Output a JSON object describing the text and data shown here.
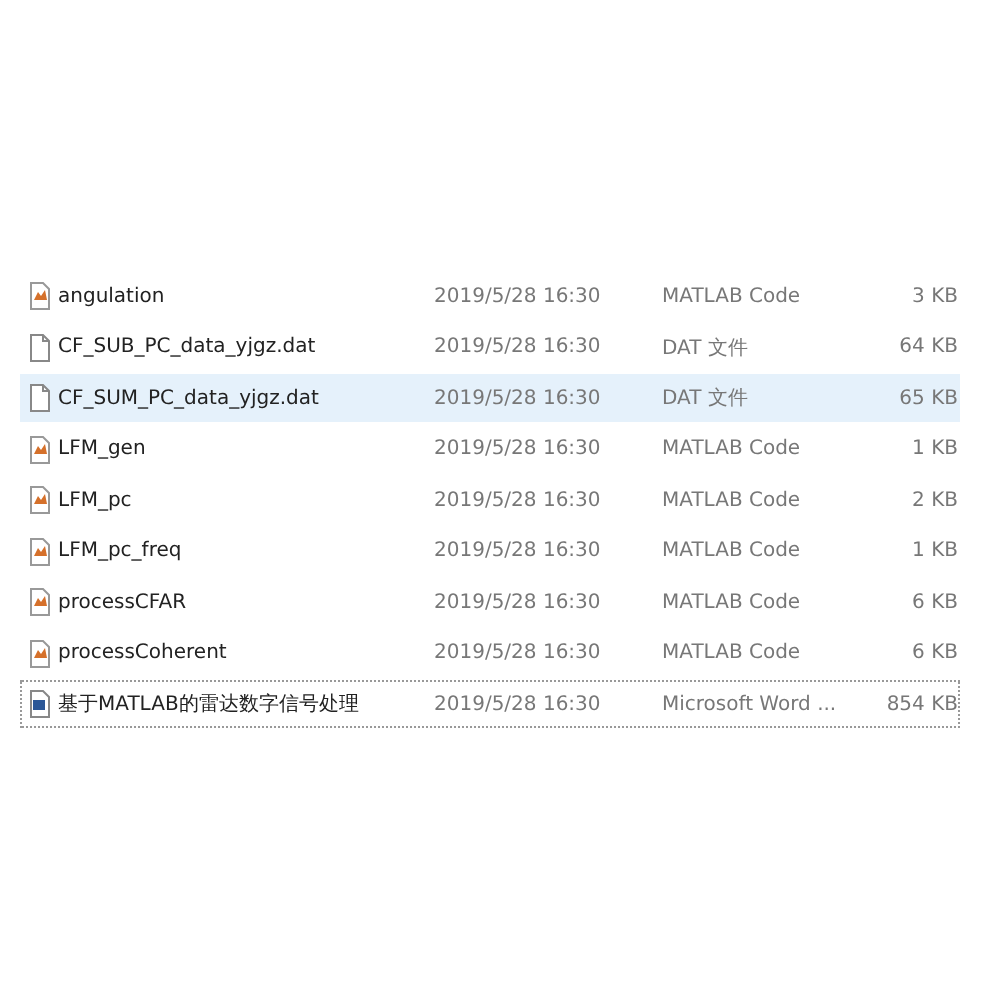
{
  "files": [
    {
      "name": "angulation",
      "date": "2019/5/28 16:30",
      "type": "MATLAB Code",
      "size": "3 KB",
      "kind": "matlab",
      "selected": false,
      "focused": false
    },
    {
      "name": "CF_SUB_PC_data_yjgz.dat",
      "date": "2019/5/28 16:30",
      "type": "DAT 文件",
      "size": "64 KB",
      "kind": "dat",
      "selected": false,
      "focused": false
    },
    {
      "name": "CF_SUM_PC_data_yjgz.dat",
      "date": "2019/5/28 16:30",
      "type": "DAT 文件",
      "size": "65 KB",
      "kind": "dat",
      "selected": true,
      "focused": false
    },
    {
      "name": "LFM_gen",
      "date": "2019/5/28 16:30",
      "type": "MATLAB Code",
      "size": "1 KB",
      "kind": "matlab",
      "selected": false,
      "focused": false
    },
    {
      "name": "LFM_pc",
      "date": "2019/5/28 16:30",
      "type": "MATLAB Code",
      "size": "2 KB",
      "kind": "matlab",
      "selected": false,
      "focused": false
    },
    {
      "name": "LFM_pc_freq",
      "date": "2019/5/28 16:30",
      "type": "MATLAB Code",
      "size": "1 KB",
      "kind": "matlab",
      "selected": false,
      "focused": false
    },
    {
      "name": "processCFAR",
      "date": "2019/5/28 16:30",
      "type": "MATLAB Code",
      "size": "6 KB",
      "kind": "matlab",
      "selected": false,
      "focused": false
    },
    {
      "name": "processCoherent",
      "date": "2019/5/28 16:30",
      "type": "MATLAB Code",
      "size": "6 KB",
      "kind": "matlab",
      "selected": false,
      "focused": false
    },
    {
      "name": "基于MATLAB的雷达数字信号处理",
      "date": "2019/5/28 16:30",
      "type": "Microsoft Word ...",
      "size": "854 KB",
      "kind": "word",
      "selected": false,
      "focused": true
    }
  ]
}
